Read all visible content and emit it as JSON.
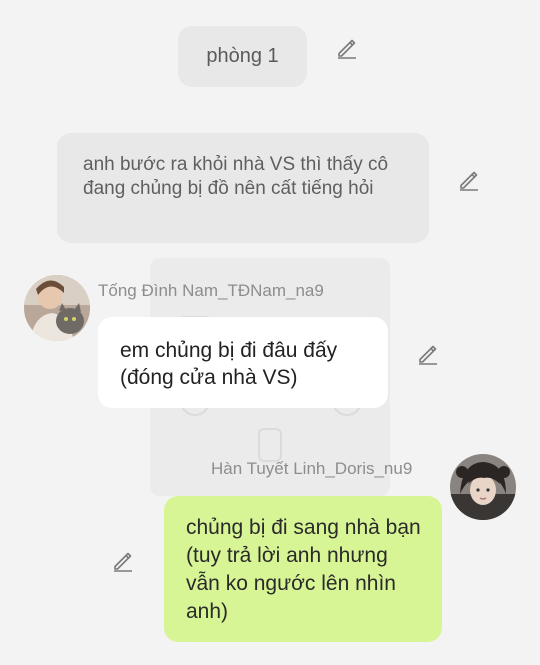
{
  "scene": {
    "label": "phòng 1"
  },
  "narration": {
    "text": "anh bước ra khỏi nhà VS thì thấy cô đang chủng bị đồ nên cất tiếng hỏi"
  },
  "messages": [
    {
      "sender": "Tống Đình Nam_TĐNam_na9",
      "text": "em chủng bị đi đâu đấy (đóng cửa nhà VS)",
      "side": "left",
      "bubble_color": "#ffffff"
    },
    {
      "sender": "Hàn Tuyết Linh_Doris_nu9",
      "text": "chủng bị đi sang nhà bạn (tuy trả lời anh nhưng vẫn ko ngước lên nhìn anh)",
      "side": "right",
      "bubble_color": "#d8f595"
    }
  ],
  "icons": {
    "edit": "pencil-edit-icon"
  },
  "colors": {
    "background": "#f3f3f3",
    "system_bubble": "#e8e8e8",
    "incoming_bubble": "#ffffff",
    "outgoing_bubble": "#d8f595",
    "name_text": "#8d8d8d"
  }
}
